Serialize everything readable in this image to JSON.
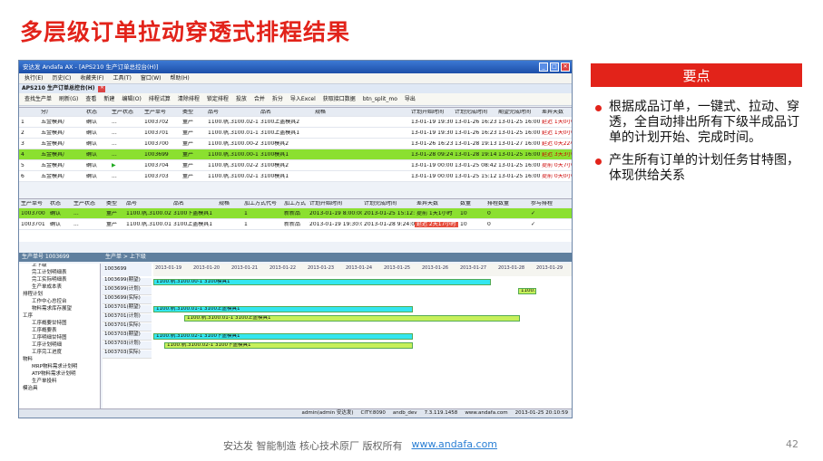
{
  "slide": {
    "title": "多层级订单拉动穿透式排程结果",
    "page_number": "42"
  },
  "footer": {
    "text": "安达发  智能制造 核心技术原厂  版权所有",
    "link": "www.andafa.com"
  },
  "keypoints": {
    "header": "要点",
    "items": [
      "根据成品订单，一键式、拉动、穿透，全自动排出所有下级半成品订单的计划开始、完成时间。",
      "产生所有订单的计划任务甘特图，体现供给关系"
    ]
  },
  "window": {
    "title": "安达发 Andafa AX - [APS210 生产订单总控台(H)]",
    "menu": [
      "执行(E)",
      "历史(C)",
      "收藏夹(F)",
      "工具(T)",
      "窗口(W)",
      "帮助(H)"
    ],
    "subtitle": "APS210 生产订单总控台(H)",
    "toolbar": [
      "查找生产单",
      "刷新(G)",
      "查看",
      "新建",
      "编辑(O)",
      "排程试算",
      "清除排程",
      "锁定排程",
      "投放",
      "合并",
      "拆分",
      "导入Excel",
      "获取接口数据",
      "btn_split_mo",
      "导出"
    ],
    "order_headers": [
      "分厂",
      "状态",
      "生产状态",
      "生产单号",
      "类型",
      "品号",
      "品名",
      "规格",
      "计划开始时间",
      "计划完成时间",
      "期望完成时间",
      "差异天数"
    ],
    "orders": [
      {
        "n": "1",
        "f": "五金模具厂",
        "s": "确认",
        "p": "...",
        "no": "1003702",
        "t": "量产",
        "code": "1100.帆.3100.02-1",
        "name": "3100上盖模具2",
        "start": "13-01-19 19:30",
        "end": "13-01-26 16:23",
        "want": "13-01-25 16:00",
        "diff": "延迟 1天0小时"
      },
      {
        "n": "2",
        "f": "五金模具厂",
        "s": "确认",
        "p": "...",
        "no": "1003701",
        "t": "量产",
        "code": "1100.帆.3100.01-1",
        "name": "3100上盖模具1",
        "start": "13-01-19 19:30",
        "end": "13-01-26 16:23",
        "want": "13-01-25 16:00",
        "diff": "延迟 1天0小时"
      },
      {
        "n": "3",
        "f": "五金模具厂",
        "s": "确认",
        "p": "...",
        "no": "1003700",
        "t": "量产",
        "code": "1100.帆.3100.00-2",
        "name": "3100模具2",
        "start": "13-01-26 16:23",
        "end": "13-01-28 19:13",
        "want": "13-01-27 16:00",
        "diff": "延迟 0天22小时"
      },
      {
        "n": "4",
        "f": "五金模具厂",
        "s": "确认",
        "p": "...",
        "no": "1003699",
        "t": "量产",
        "code": "1100.帆.3100.00-1",
        "name": "3100模具1",
        "start": "13-01-28 09:24",
        "end": "13-01-28 19:14",
        "want": "13-01-25 16:00",
        "diff": "延迟 3天3小时"
      },
      {
        "n": "5",
        "f": "五金模具厂",
        "s": "确认",
        "p": "▶",
        "no": "1003704",
        "t": "量产",
        "code": "1100.帆.3100.02-2",
        "name": "3100模具2",
        "start": "13-01-19 00:00",
        "end": "13-01-25 08:42",
        "want": "13-01-25 16:00",
        "diff": "提前 0天7小时"
      },
      {
        "n": "6",
        "f": "五金模具厂",
        "s": "确认",
        "p": "...",
        "no": "1003703",
        "t": "量产",
        "code": "1100.帆.3100.02-1",
        "name": "3100模具1",
        "start": "13-01-19 00:00",
        "end": "13-01-25 15:12",
        "want": "13-01-25 16:00",
        "diff": "提前 0天0小时"
      }
    ],
    "sub_headers": [
      "生产单号",
      "状态",
      "生产状态",
      "类型",
      "品号",
      "品名",
      "规格",
      "加工方式代号",
      "加工方式",
      "计划开始时间",
      "计划完成时间",
      "差异天数",
      "数量",
      "排程数量",
      "参与排程"
    ],
    "sub_rows": [
      {
        "no": "1003700",
        "s": "确认",
        "p": "...",
        "t": "量产",
        "code": "1100.帆.3100.02-1",
        "name": "3100下盖模具1",
        "m": "1",
        "mt": "新新品",
        "start": "2013-01-19 8:00:00",
        "end": "2013-01-25 15:12:00",
        "diff": "提前 1天1小时",
        "q": "10",
        "sq": "0",
        "chk": "✓"
      },
      {
        "no": "1003701",
        "s": "确认",
        "p": "...",
        "t": "量产",
        "code": "1100.帆.3100.01-1",
        "name": "3100上盖模具1",
        "m": "1",
        "mt": "新新品",
        "start": "2013-01-19 19:30:00",
        "end": "2013-01-28 9:24:00",
        "diff": "延迟 2天17小时",
        "q": "10",
        "sq": "0",
        "chk": "✓"
      }
    ],
    "lower_bar": "生产单号 1003699",
    "gantt_bar": "生产单 > 上下级",
    "tree": [
      "上下级",
      "完工计划明细表",
      "完工实际明细表",
      "生产单成本表",
      "排程计划",
      "工作中心总控台",
      "物料需求库存展望",
      "工序",
      "工序概要甘特图",
      "工序概要表",
      "工序明细甘特图",
      "工序计划明细",
      "工序完工进度",
      "物料",
      "MRP物料需求计划明",
      "ATP物料需求计划明",
      "生产单投料",
      "模治具"
    ],
    "gantt_order": "1003699",
    "gantt_dates": [
      "2013-01-19",
      "2013-01-20",
      "2013-01-21",
      "2013-01-22",
      "2013-01-23",
      "2013-01-24",
      "2013-01-25",
      "2013-01-26",
      "2013-01-27",
      "2013-01-28",
      "2013-01-29"
    ],
    "gantt_rows": [
      {
        "label": "1003699(期望)",
        "bar": "1100.帆.3100.00-1  3100模具1"
      },
      {
        "label": "1003699(计划)",
        "bar": "1100."
      },
      {
        "label": "1003699(实际)",
        "bar": ""
      },
      {
        "label": "1003701(期望)",
        "bar": "1100.帆.3100.01-1  3100上盖模具1"
      },
      {
        "label": "1003701(计划)",
        "bar": "1100.帆.3100.01-1  3100上盖模具1"
      },
      {
        "label": "1003701(实际)",
        "bar": ""
      },
      {
        "label": "1003703(期望)",
        "bar": "1100.帆.3100.02-1  3100下盖模具1"
      },
      {
        "label": "1003703(计划)",
        "bar": "1100.帆.3100.02-1  3100下盖模具1"
      },
      {
        "label": "1003703(实际)",
        "bar": ""
      }
    ],
    "status": [
      "admin(admin 安达发)",
      "CITY:8090",
      "andb_dev",
      "7.3.119.1458",
      "www.andafa.com",
      "2013-01-25 20:10:59"
    ]
  }
}
